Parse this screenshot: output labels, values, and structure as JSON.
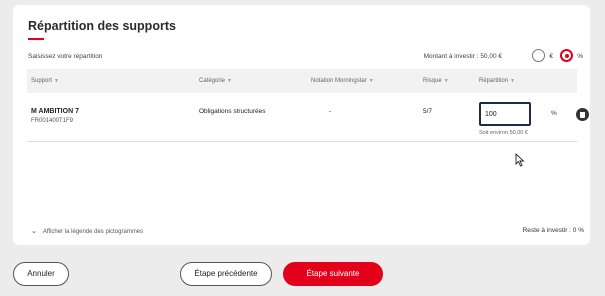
{
  "header": {
    "title": "Répartition des supports",
    "subtitle": "Saisissez votre répartition",
    "amount": "Montant à investir : 50,00 €"
  },
  "toggle": {
    "eur_label": "€",
    "pct_label": "%",
    "selected": "pct"
  },
  "table": {
    "columns": [
      "Support",
      "Catégorie",
      "Notation Morningstar",
      "Risque",
      "Répartition"
    ],
    "rows": [
      {
        "name": "M AMBITION 7",
        "isin": "FR001400T1F9",
        "category": "Obligations structurées",
        "morningstar": "-",
        "risk": "5/7",
        "repartition": "100",
        "unit": "%",
        "approx": "Soit environ 50,00 €"
      }
    ]
  },
  "footer": {
    "legend_toggle": "Afficher la légende des pictogrammes",
    "reste": "Reste à investir : 0 %"
  },
  "actions": {
    "cancel": "Annuler",
    "previous": "Étape précédente",
    "next": "Étape suivante"
  },
  "colors": {
    "accent": "#e2001a",
    "input_border": "#1f2b44"
  }
}
